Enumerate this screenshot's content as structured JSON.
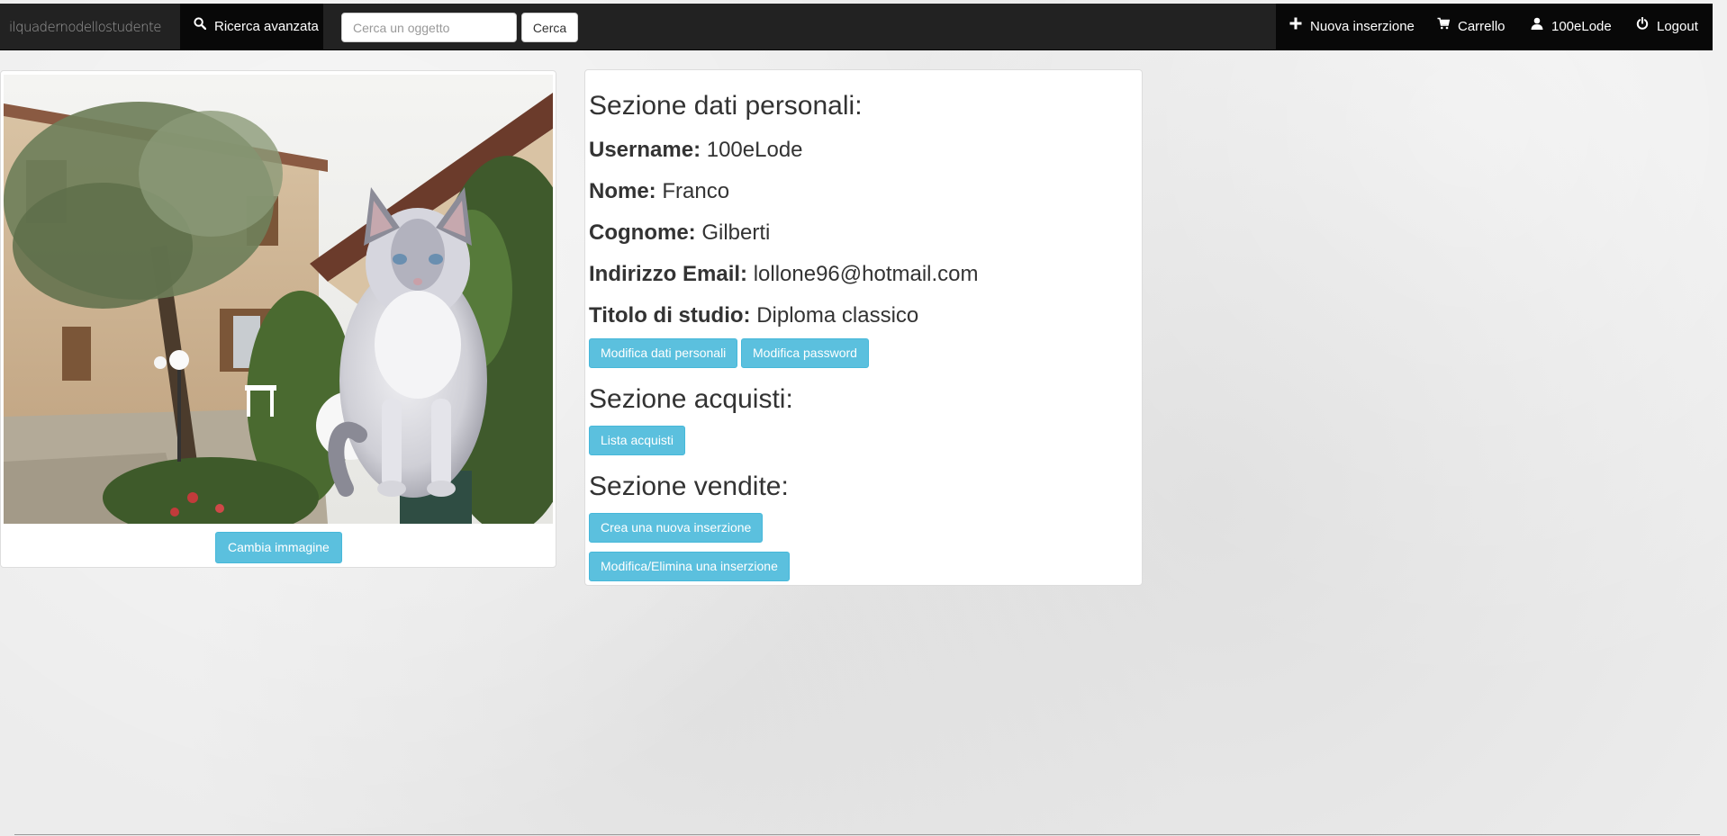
{
  "navbar": {
    "brand": "ilquadernodellostudente",
    "advanced_search_label": "Ricerca avanzata",
    "search": {
      "placeholder": "Cerca un oggetto",
      "value": "",
      "button_label": "Cerca"
    },
    "new_listing_label": "Nuova inserzione",
    "cart_label": "Carrello",
    "user_label": "100eLode",
    "logout_label": "Logout"
  },
  "profile_image": {
    "change_button_label": "Cambia immagine"
  },
  "personal": {
    "title": "Sezione dati personali:",
    "fields": [
      {
        "label": "Username:",
        "value": "100eLode"
      },
      {
        "label": "Nome:",
        "value": "Franco"
      },
      {
        "label": "Cognome:",
        "value": "Gilberti"
      },
      {
        "label": "Indirizzo Email:",
        "value": "lollone96@hotmail.com"
      },
      {
        "label": "Titolo di studio:",
        "value": "Diploma classico"
      }
    ],
    "edit_data_button": "Modifica dati personali",
    "edit_password_button": "Modifica password"
  },
  "purchases": {
    "title": "Sezione acquisti:",
    "list_button": "Lista acquisti"
  },
  "sales": {
    "title": "Sezione vendite:",
    "create_button": "Crea una nuova inserzione",
    "edit_button": "Modifica/Elimina una inserzione"
  },
  "colors": {
    "navbar_bg": "#222222",
    "navbar_active_bg": "#080808",
    "info_button": "#5bc0de",
    "page_bg": "#ececec"
  },
  "icons": {
    "advanced_search": "search-icon",
    "new_listing": "plus-icon",
    "cart": "cart-icon",
    "user": "user-icon",
    "logout": "power-icon"
  }
}
